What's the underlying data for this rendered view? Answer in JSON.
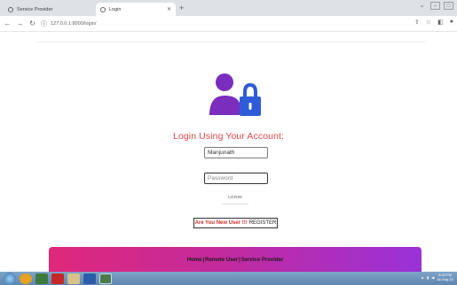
{
  "browser": {
    "tabs": [
      {
        "title": "Service Provider"
      },
      {
        "title": "Login"
      }
    ],
    "new_tab_glyph": "+",
    "address": "127.0.0.1:8000/login/"
  },
  "page": {
    "login_title": "Login Using Your Account:",
    "username_value": "Manjunath",
    "password_placeholder": "Password",
    "login_button": "LOGIN",
    "register_prompt": "Are You New User !!!",
    "register_link": "REGISTER",
    "footer": {
      "home": "Home",
      "remote_user": "Remote User",
      "service_provider": "Service Provider"
    }
  },
  "taskbar": {
    "time": "8:34 PM",
    "date": "16-Aug-22"
  },
  "colors": {
    "title": "#e04848",
    "icon_blue": "#2f5bd8",
    "icon_purple": "#7b2dbe",
    "footer_start": "#e0287a",
    "footer_end": "#9a32d8"
  }
}
